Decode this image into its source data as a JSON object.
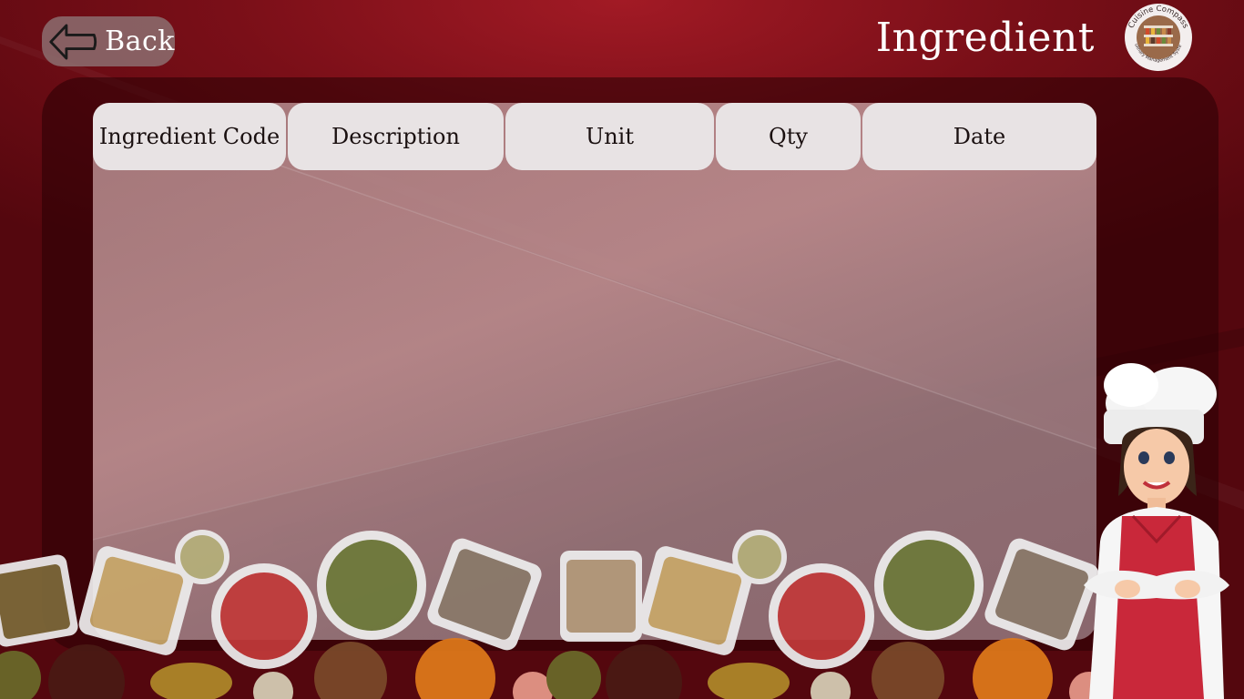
{
  "header": {
    "back_label": "Back",
    "title": "Ingredient"
  },
  "logo": {
    "text": "Cuisine Compass",
    "subtext": "Culinary Management System"
  },
  "table": {
    "columns": [
      "Ingredient Code",
      "Description",
      "Unit",
      "Qty",
      "Date"
    ],
    "rows": []
  },
  "colors": {
    "background": "#7a0f18",
    "header_cell": "#e8e3e4",
    "header_text": "#1a1010",
    "title_text": "#ffffff"
  },
  "icons": {
    "back": "arrow-left-icon",
    "logo": "cuisine-compass-logo",
    "chef": "chef-illustration"
  }
}
